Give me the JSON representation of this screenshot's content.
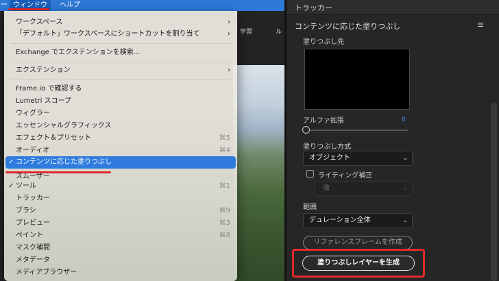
{
  "menubar": {
    "items": [
      "ー",
      "ウィンドウ",
      "ヘルプ"
    ]
  },
  "background_tabs": [
    "学習",
    "ル"
  ],
  "window_menu": {
    "items": [
      {
        "label": "ワークスペース",
        "submenu": true
      },
      {
        "label": "「デフォルト」ワークスペースにショートカットを割り当て"
      },
      {
        "label": "Exchange でエクステンションを検索..."
      },
      {
        "label": "エクステンション",
        "submenu": true
      },
      {
        "label": "Frame.io で確認する"
      },
      {
        "label": "Lumetri スコープ"
      },
      {
        "label": "ウィグラー"
      },
      {
        "label": "エッセンシャルグラフィックス"
      },
      {
        "label": "エフェクト＆プリセット",
        "shortcut": "⌘5"
      },
      {
        "label": "オーディオ",
        "shortcut": "⌘4"
      },
      {
        "label": "コンテンツに応じた塗りつぶし",
        "checked": true,
        "selected": true
      },
      {
        "label": "スムーザー"
      },
      {
        "label": "ツール",
        "checked": true,
        "shortcut": "⌘1"
      },
      {
        "label": "トラッカー"
      },
      {
        "label": "ブラシ",
        "shortcut": "⌘9"
      },
      {
        "label": "プレビュー",
        "shortcut": "⌘3"
      },
      {
        "label": "ペイント",
        "shortcut": "⌘8"
      },
      {
        "label": "マスク補間"
      },
      {
        "label": "メタデータ"
      },
      {
        "label": "メディアブラウザー"
      }
    ],
    "checkmark": "✓",
    "submenu_arrow": "›"
  },
  "panel": {
    "tracker_title": "トラッカー",
    "title": "コンテンツに応じた塗りつぶし",
    "menu_icon": "≡",
    "fill_target_label": "塗りつぶし先",
    "alpha_expand_label": "アルファ拡張",
    "alpha_expand_value": "0",
    "fill_method_label": "塗りつぶし方式",
    "fill_method_value": "オブジェクト",
    "lighting_label": "ライティング補正",
    "lighting_checked": false,
    "strength_value": "強",
    "range_label": "範囲",
    "range_value": "デュレーション全体",
    "reference_button": "リファレンスフレームを作成",
    "generate_button": "塗りつぶしレイヤーを生成"
  },
  "colors": {
    "accent": "#2f7bde",
    "annotation": "#e32a2a",
    "value_blue": "#3d9af2"
  }
}
